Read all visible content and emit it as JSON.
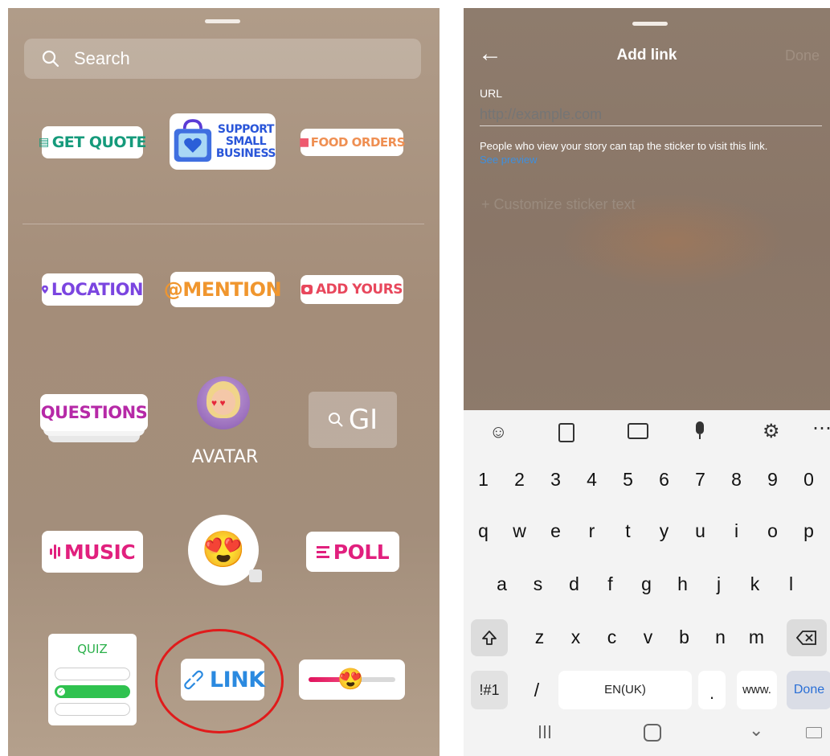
{
  "left": {
    "search": {
      "placeholder": "Search"
    },
    "stickers": {
      "get_quote": "GET QUOTE",
      "support_small_business": [
        "SUPPORT",
        "SMALL",
        "BUSINESS"
      ],
      "food_orders": "FOOD ORDERS",
      "location": "LOCATION",
      "mention": "@MENTION",
      "add_yours": "ADD YOURS",
      "questions": "QUESTIONS",
      "avatar": "AVATAR",
      "gif": "GI",
      "music": "MUSIC",
      "emoji": "😍",
      "poll": "POLL",
      "quiz": "QUIZ",
      "link": "LINK",
      "slider_emoji": "😍"
    },
    "highlight_color": "#e01b1b"
  },
  "right": {
    "header": {
      "back": "←",
      "title": "Add link",
      "done": "Done"
    },
    "url": {
      "label": "URL",
      "placeholder": "http://example.com"
    },
    "helper_text": "People who view your story can tap the sticker to visit this link.",
    "see_preview": "See preview",
    "customize": "+ Customize sticker text",
    "keyboard": {
      "toolbar_icons": [
        "emoji-icon",
        "clipboard-icon",
        "keyboard-icon",
        "microphone-icon",
        "settings-icon",
        "more-icon"
      ],
      "numbers": [
        "1",
        "2",
        "3",
        "4",
        "5",
        "6",
        "7",
        "8",
        "9",
        "0"
      ],
      "row1": [
        "q",
        "w",
        "e",
        "r",
        "t",
        "y",
        "u",
        "i",
        "o",
        "p"
      ],
      "row2": [
        "a",
        "s",
        "d",
        "f",
        "g",
        "h",
        "j",
        "k",
        "l"
      ],
      "row3": [
        "z",
        "x",
        "c",
        "v",
        "b",
        "n",
        "m"
      ],
      "symbols": "!#1",
      "slash": "/",
      "space": "EN(UK)",
      "period": ".",
      "www": "www.",
      "done": "Done"
    },
    "navbar": {
      "icons": [
        "recent-apps-icon",
        "home-icon",
        "back-icon",
        "keyboard-switch-icon"
      ]
    }
  }
}
